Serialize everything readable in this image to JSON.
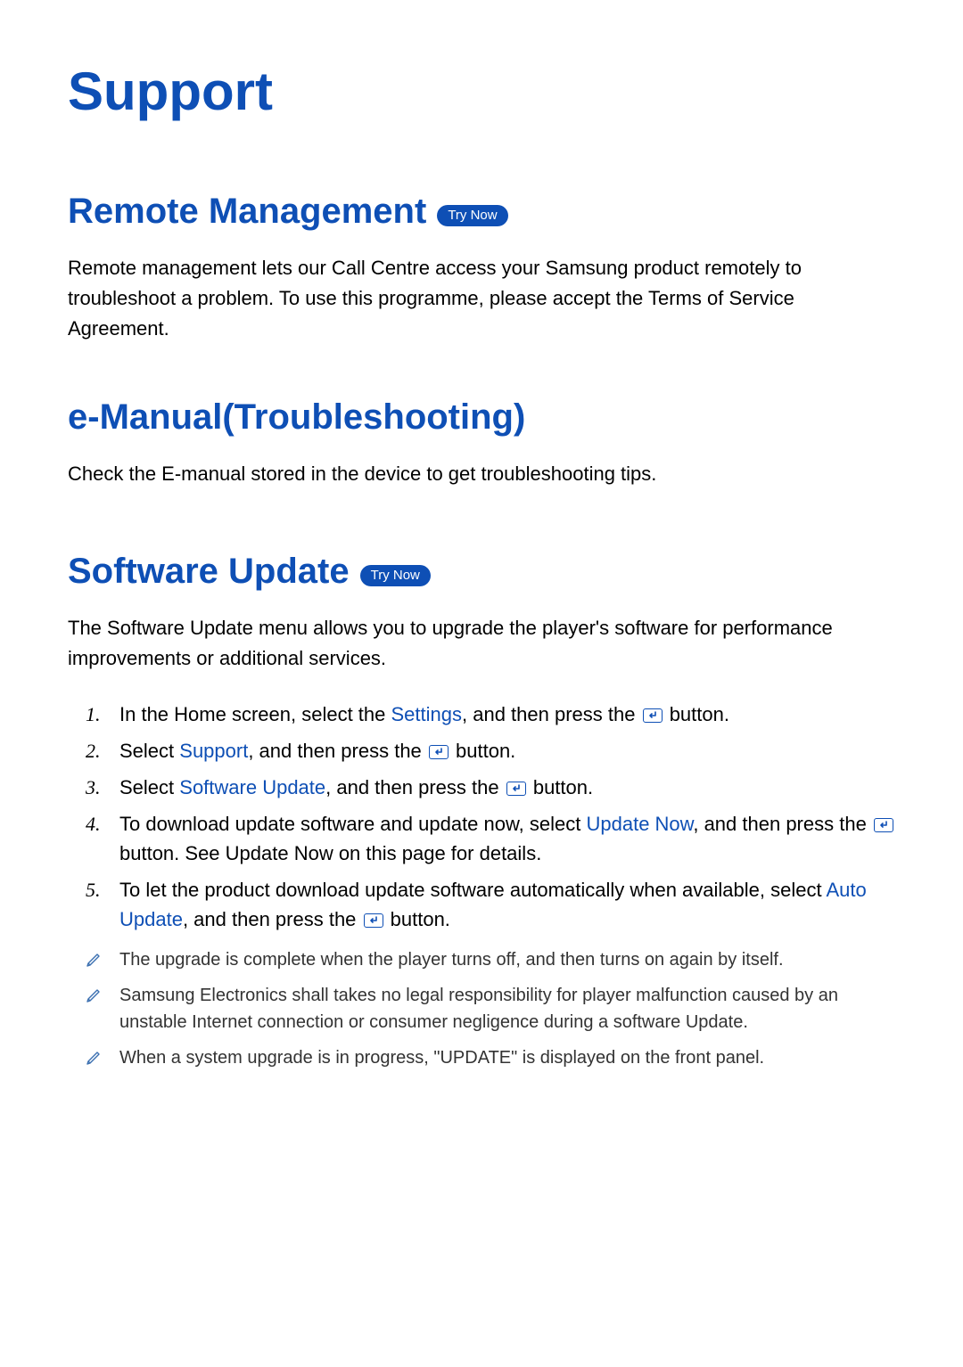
{
  "page_title": "Support",
  "badges": {
    "try_now": "Try Now"
  },
  "sections": {
    "remote_management": {
      "heading": "Remote Management",
      "body": "Remote management lets our Call Centre access your Samsung product remotely to troubleshoot a problem. To use this programme, please accept the Terms of Service Agreement."
    },
    "e_manual": {
      "heading": "e-Manual(Troubleshooting)",
      "body": "Check the E-manual stored in the device to get troubleshooting tips."
    },
    "software_update": {
      "heading": "Software Update",
      "intro": "The Software Update menu allows you to upgrade the player's software for performance improvements or additional services.",
      "steps": [
        {
          "pre": "In the Home screen, select the ",
          "link": "Settings",
          "mid": ", and then press the ",
          "post": " button."
        },
        {
          "pre": "Select ",
          "link": "Support",
          "mid": ", and then press the ",
          "post": " button."
        },
        {
          "pre": "Select ",
          "link": "Software Update",
          "mid": ", and then press the ",
          "post": " button."
        },
        {
          "pre": "To download update software and update now, select ",
          "link": "Update Now",
          "mid": ", and then press the ",
          "post": " button. See Update Now on this page for details."
        },
        {
          "pre": "To let the product download update software automatically when available, select ",
          "link": "Auto Update",
          "mid": ", and then press the ",
          "post": " button."
        }
      ],
      "notes": [
        "The upgrade is complete when the player turns off, and then turns on again by itself.",
        "Samsung Electronics shall takes no legal responsibility for player malfunction caused by an unstable Internet connection or consumer negligence during a software Update.",
        "When a system upgrade is in progress, \"UPDATE\" is displayed on the front panel."
      ]
    }
  }
}
